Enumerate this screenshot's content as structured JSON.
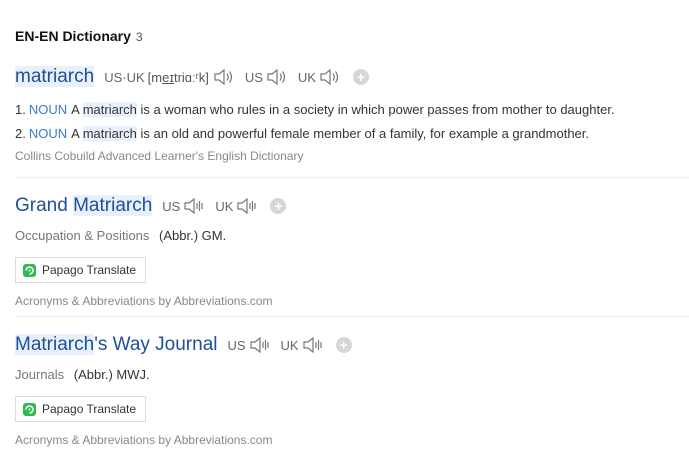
{
  "header": {
    "title": "EN-EN Dictionary",
    "count": "3"
  },
  "entry1": {
    "word": "matriarch",
    "us_uk_label": "US·UK",
    "ipa_prefix": "[m",
    "ipa_underlined": "eɪ",
    "ipa_suffix": "triɑːʳk]",
    "us_label": "US",
    "uk_label": "UK",
    "definitions": [
      {
        "num": "1.",
        "pos": "NOUN",
        "pre": "A",
        "hl": "matriarch",
        "post": "is a woman who rules in a society in which power passes from mother to daughter."
      },
      {
        "num": "2.",
        "pos": "NOUN",
        "pre": "A",
        "hl": "matriarch",
        "post": "is an old and powerful female member of a family, for example a grandmother."
      }
    ],
    "source": "Collins Cobuild Advanced Learner's English Dictionary"
  },
  "entry2": {
    "word_pre": "Grand ",
    "word_hl": "Matriarch",
    "word_post": "",
    "us_label": "US",
    "uk_label": "UK",
    "category": "Occupation & Positions",
    "abbr": "(Abbr.) GM.",
    "translate_label": "Papago Translate",
    "source": "Acronyms & Abbreviations by Abbreviations.com"
  },
  "entry3": {
    "word_pre": "",
    "word_hl": "Matriarch",
    "word_post": "'s Way Journal",
    "us_label": "US",
    "uk_label": "UK",
    "category": "Journals",
    "abbr": "(Abbr.) MWJ.",
    "translate_label": "Papago Translate",
    "source": "Acronyms & Abbreviations by Abbreviations.com"
  },
  "icons": {
    "speaker": "speaker-icon",
    "add": "add-icon",
    "papago": "papago-logo-icon"
  },
  "colors": {
    "link": "#1f4e9b",
    "pos": "#3c7bd4",
    "highlight": "#e8f1fb",
    "papago_green": "#2fb94e"
  }
}
